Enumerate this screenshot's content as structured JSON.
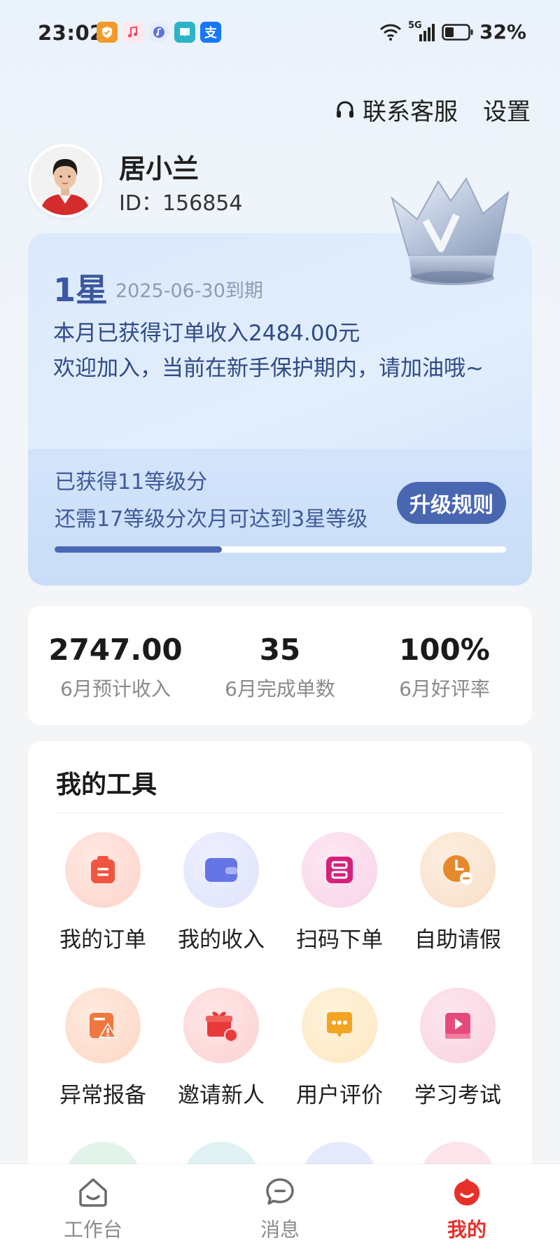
{
  "status_bar": {
    "time": "23:02",
    "network": "5G",
    "battery": "32%",
    "notification_icons": [
      "shield-app-icon",
      "music-app-icon",
      "music-note-app-icon",
      "book-app-icon",
      "alipay-app-icon"
    ],
    "alipay_glyph": "支"
  },
  "header": {
    "contact_service": "联系客服",
    "settings": "设置"
  },
  "user": {
    "name": "居小兰",
    "id_label": "ID：",
    "id_value": "156854"
  },
  "level": {
    "star": "1星",
    "expire": "2025-06-30到期",
    "income_text": "本月已获得订单收入2484.00元",
    "welcome_text": "欢迎加入，当前在新手保护期内，请加油哦~",
    "points_got": "已获得11等级分",
    "points_needed": "还需17等级分次月可达到3星等级",
    "upgrade_button": "升级规则",
    "progress_fraction": 0.37
  },
  "stats": [
    {
      "value": "2747.00",
      "label": "6月预计收入"
    },
    {
      "value": "35",
      "label": "6月完成单数"
    },
    {
      "value": "100%",
      "label": "6月好评率"
    }
  ],
  "tools": {
    "title": "我的工具",
    "items": [
      {
        "label": "我的订单",
        "icon": "order-icon"
      },
      {
        "label": "我的收入",
        "icon": "wallet-icon"
      },
      {
        "label": "扫码下单",
        "icon": "scan-icon"
      },
      {
        "label": "自助请假",
        "icon": "clock-leave-icon"
      },
      {
        "label": "异常报备",
        "icon": "warning-report-icon"
      },
      {
        "label": "邀请新人",
        "icon": "gift-invite-icon"
      },
      {
        "label": "用户评价",
        "icon": "comment-icon"
      },
      {
        "label": "学习考试",
        "icon": "video-book-icon"
      }
    ]
  },
  "tabbar": {
    "items": [
      {
        "label": "工作台",
        "icon": "home-icon",
        "active": false
      },
      {
        "label": "消息",
        "icon": "message-icon",
        "active": false
      },
      {
        "label": "我的",
        "icon": "profile-icon",
        "active": true
      }
    ],
    "active_color": "#e8302a",
    "inactive_color": "#8a8a8a"
  },
  "colors": {
    "brand_blue": "#4966b0",
    "level_text": "#3b58a0",
    "accent_red": "#e8302a"
  }
}
